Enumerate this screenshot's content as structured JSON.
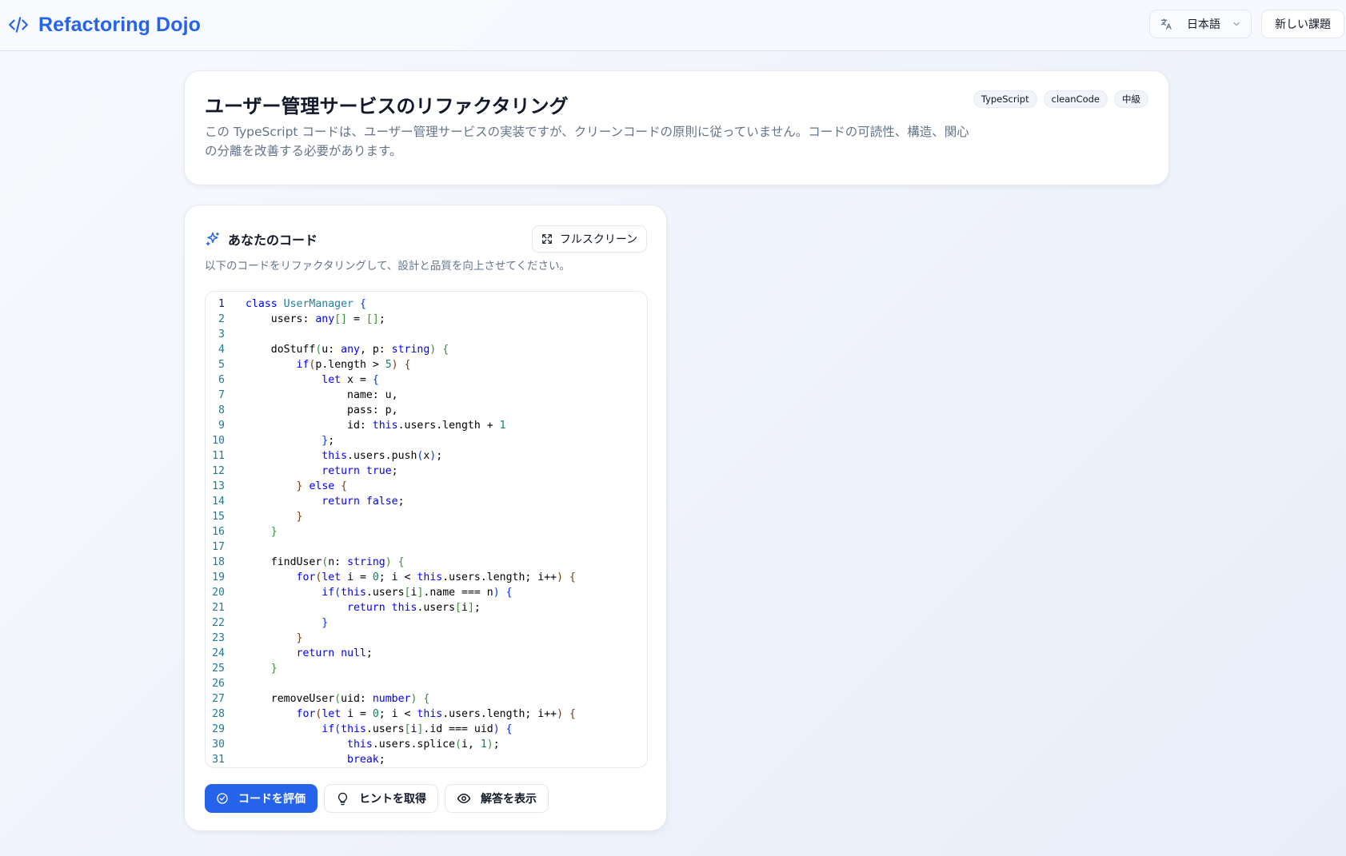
{
  "header": {
    "app_title": "Refactoring Dojo",
    "language": "日本語",
    "new_challenge": "新しい課題"
  },
  "problem": {
    "title": "ユーザー管理サービスのリファクタリング",
    "description": "この TypeScript コードは、ユーザー管理サービスの実装ですが、クリーンコードの原則に従っていません。コードの可読性、構造、関心の分離を改善する必要があります。",
    "tags": [
      "TypeScript",
      "cleanCode",
      "中級"
    ]
  },
  "editor_panel": {
    "title": "あなたのコード",
    "fullscreen": "フルスクリーン",
    "subtitle": "以下のコードをリファクタリングして、設計と品質を向上させてください。",
    "active_line": 1,
    "code": [
      "class UserManager {",
      "    users: any[] = [];",
      "",
      "    doStuff(u: any, p: string) {",
      "        if(p.length > 5) {",
      "            let x = {",
      "                name: u,",
      "                pass: p,",
      "                id: this.users.length + 1",
      "            };",
      "            this.users.push(x);",
      "            return true;",
      "        } else {",
      "            return false;",
      "        }",
      "    }",
      "",
      "    findUser(n: string) {",
      "        for(let i = 0; i < this.users.length; i++) {",
      "            if(this.users[i].name === n) {",
      "                return this.users[i];",
      "            }",
      "        }",
      "        return null;",
      "    }",
      "",
      "    removeUser(uid: number) {",
      "        for(let i = 0; i < this.users.length; i++) {",
      "            if(this.users[i].id === uid) {",
      "                this.users.splice(i, 1);",
      "                break;",
      "            }"
    ]
  },
  "actions": {
    "evaluate": "コードを評価",
    "hint": "ヒントを取得",
    "solution": "解答を表示"
  },
  "icons": {
    "logo": "code-icon",
    "language": "translate-icon",
    "dropdown": "chevron-down-icon",
    "editor_title": "sparkles-icon",
    "fullscreen": "expand-icon",
    "evaluate": "check-circle-icon",
    "hint": "lightbulb-icon",
    "solution": "eye-icon"
  },
  "colors": {
    "accent": "#2563eb",
    "muted_text": "#64748b",
    "keyword": "#0000ff",
    "type": "#267f99",
    "number": "#098658",
    "bracket_1": "#0431fa",
    "bracket_2": "#319331",
    "bracket_3": "#7b3814",
    "line_number": "#237893"
  }
}
